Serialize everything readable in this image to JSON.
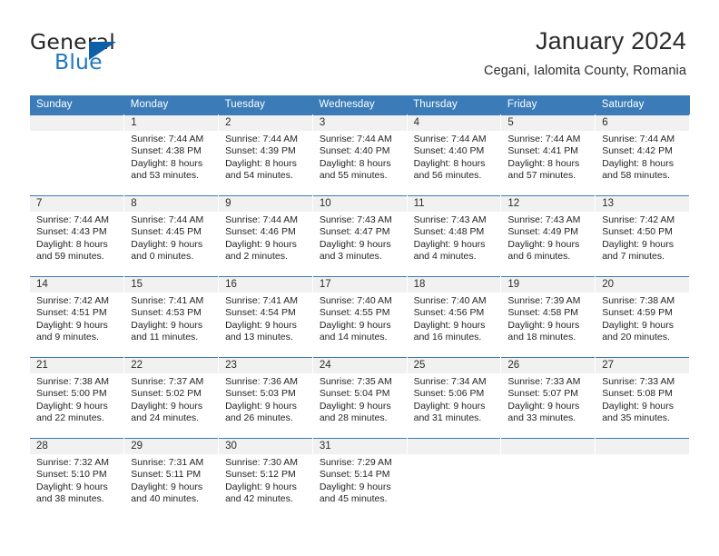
{
  "logo": {
    "word_top": "General",
    "word_bottom": "Blue",
    "accent_color": "#0f5fa8",
    "blue_text_color": "#2077c3"
  },
  "header": {
    "title": "January 2024",
    "subtitle": "Cegani, Ialomita County, Romania"
  },
  "calendar": {
    "header_bg": "#3b7cb8",
    "daynum_bg": "#f1f1f1",
    "weekdays": [
      "Sunday",
      "Monday",
      "Tuesday",
      "Wednesday",
      "Thursday",
      "Friday",
      "Saturday"
    ],
    "weeks": [
      [
        {
          "day": "",
          "sunrise": "",
          "sunset": "",
          "daylight_line1": "",
          "daylight_line2": ""
        },
        {
          "day": "1",
          "sunrise": "Sunrise: 7:44 AM",
          "sunset": "Sunset: 4:38 PM",
          "daylight_line1": "Daylight: 8 hours",
          "daylight_line2": "and 53 minutes."
        },
        {
          "day": "2",
          "sunrise": "Sunrise: 7:44 AM",
          "sunset": "Sunset: 4:39 PM",
          "daylight_line1": "Daylight: 8 hours",
          "daylight_line2": "and 54 minutes."
        },
        {
          "day": "3",
          "sunrise": "Sunrise: 7:44 AM",
          "sunset": "Sunset: 4:40 PM",
          "daylight_line1": "Daylight: 8 hours",
          "daylight_line2": "and 55 minutes."
        },
        {
          "day": "4",
          "sunrise": "Sunrise: 7:44 AM",
          "sunset": "Sunset: 4:40 PM",
          "daylight_line1": "Daylight: 8 hours",
          "daylight_line2": "and 56 minutes."
        },
        {
          "day": "5",
          "sunrise": "Sunrise: 7:44 AM",
          "sunset": "Sunset: 4:41 PM",
          "daylight_line1": "Daylight: 8 hours",
          "daylight_line2": "and 57 minutes."
        },
        {
          "day": "6",
          "sunrise": "Sunrise: 7:44 AM",
          "sunset": "Sunset: 4:42 PM",
          "daylight_line1": "Daylight: 8 hours",
          "daylight_line2": "and 58 minutes."
        }
      ],
      [
        {
          "day": "7",
          "sunrise": "Sunrise: 7:44 AM",
          "sunset": "Sunset: 4:43 PM",
          "daylight_line1": "Daylight: 8 hours",
          "daylight_line2": "and 59 minutes."
        },
        {
          "day": "8",
          "sunrise": "Sunrise: 7:44 AM",
          "sunset": "Sunset: 4:45 PM",
          "daylight_line1": "Daylight: 9 hours",
          "daylight_line2": "and 0 minutes."
        },
        {
          "day": "9",
          "sunrise": "Sunrise: 7:44 AM",
          "sunset": "Sunset: 4:46 PM",
          "daylight_line1": "Daylight: 9 hours",
          "daylight_line2": "and 2 minutes."
        },
        {
          "day": "10",
          "sunrise": "Sunrise: 7:43 AM",
          "sunset": "Sunset: 4:47 PM",
          "daylight_line1": "Daylight: 9 hours",
          "daylight_line2": "and 3 minutes."
        },
        {
          "day": "11",
          "sunrise": "Sunrise: 7:43 AM",
          "sunset": "Sunset: 4:48 PM",
          "daylight_line1": "Daylight: 9 hours",
          "daylight_line2": "and 4 minutes."
        },
        {
          "day": "12",
          "sunrise": "Sunrise: 7:43 AM",
          "sunset": "Sunset: 4:49 PM",
          "daylight_line1": "Daylight: 9 hours",
          "daylight_line2": "and 6 minutes."
        },
        {
          "day": "13",
          "sunrise": "Sunrise: 7:42 AM",
          "sunset": "Sunset: 4:50 PM",
          "daylight_line1": "Daylight: 9 hours",
          "daylight_line2": "and 7 minutes."
        }
      ],
      [
        {
          "day": "14",
          "sunrise": "Sunrise: 7:42 AM",
          "sunset": "Sunset: 4:51 PM",
          "daylight_line1": "Daylight: 9 hours",
          "daylight_line2": "and 9 minutes."
        },
        {
          "day": "15",
          "sunrise": "Sunrise: 7:41 AM",
          "sunset": "Sunset: 4:53 PM",
          "daylight_line1": "Daylight: 9 hours",
          "daylight_line2": "and 11 minutes."
        },
        {
          "day": "16",
          "sunrise": "Sunrise: 7:41 AM",
          "sunset": "Sunset: 4:54 PM",
          "daylight_line1": "Daylight: 9 hours",
          "daylight_line2": "and 13 minutes."
        },
        {
          "day": "17",
          "sunrise": "Sunrise: 7:40 AM",
          "sunset": "Sunset: 4:55 PM",
          "daylight_line1": "Daylight: 9 hours",
          "daylight_line2": "and 14 minutes."
        },
        {
          "day": "18",
          "sunrise": "Sunrise: 7:40 AM",
          "sunset": "Sunset: 4:56 PM",
          "daylight_line1": "Daylight: 9 hours",
          "daylight_line2": "and 16 minutes."
        },
        {
          "day": "19",
          "sunrise": "Sunrise: 7:39 AM",
          "sunset": "Sunset: 4:58 PM",
          "daylight_line1": "Daylight: 9 hours",
          "daylight_line2": "and 18 minutes."
        },
        {
          "day": "20",
          "sunrise": "Sunrise: 7:38 AM",
          "sunset": "Sunset: 4:59 PM",
          "daylight_line1": "Daylight: 9 hours",
          "daylight_line2": "and 20 minutes."
        }
      ],
      [
        {
          "day": "21",
          "sunrise": "Sunrise: 7:38 AM",
          "sunset": "Sunset: 5:00 PM",
          "daylight_line1": "Daylight: 9 hours",
          "daylight_line2": "and 22 minutes."
        },
        {
          "day": "22",
          "sunrise": "Sunrise: 7:37 AM",
          "sunset": "Sunset: 5:02 PM",
          "daylight_line1": "Daylight: 9 hours",
          "daylight_line2": "and 24 minutes."
        },
        {
          "day": "23",
          "sunrise": "Sunrise: 7:36 AM",
          "sunset": "Sunset: 5:03 PM",
          "daylight_line1": "Daylight: 9 hours",
          "daylight_line2": "and 26 minutes."
        },
        {
          "day": "24",
          "sunrise": "Sunrise: 7:35 AM",
          "sunset": "Sunset: 5:04 PM",
          "daylight_line1": "Daylight: 9 hours",
          "daylight_line2": "and 28 minutes."
        },
        {
          "day": "25",
          "sunrise": "Sunrise: 7:34 AM",
          "sunset": "Sunset: 5:06 PM",
          "daylight_line1": "Daylight: 9 hours",
          "daylight_line2": "and 31 minutes."
        },
        {
          "day": "26",
          "sunrise": "Sunrise: 7:33 AM",
          "sunset": "Sunset: 5:07 PM",
          "daylight_line1": "Daylight: 9 hours",
          "daylight_line2": "and 33 minutes."
        },
        {
          "day": "27",
          "sunrise": "Sunrise: 7:33 AM",
          "sunset": "Sunset: 5:08 PM",
          "daylight_line1": "Daylight: 9 hours",
          "daylight_line2": "and 35 minutes."
        }
      ],
      [
        {
          "day": "28",
          "sunrise": "Sunrise: 7:32 AM",
          "sunset": "Sunset: 5:10 PM",
          "daylight_line1": "Daylight: 9 hours",
          "daylight_line2": "and 38 minutes."
        },
        {
          "day": "29",
          "sunrise": "Sunrise: 7:31 AM",
          "sunset": "Sunset: 5:11 PM",
          "daylight_line1": "Daylight: 9 hours",
          "daylight_line2": "and 40 minutes."
        },
        {
          "day": "30",
          "sunrise": "Sunrise: 7:30 AM",
          "sunset": "Sunset: 5:12 PM",
          "daylight_line1": "Daylight: 9 hours",
          "daylight_line2": "and 42 minutes."
        },
        {
          "day": "31",
          "sunrise": "Sunrise: 7:29 AM",
          "sunset": "Sunset: 5:14 PM",
          "daylight_line1": "Daylight: 9 hours",
          "daylight_line2": "and 45 minutes."
        },
        {
          "day": "",
          "sunrise": "",
          "sunset": "",
          "daylight_line1": "",
          "daylight_line2": ""
        },
        {
          "day": "",
          "sunrise": "",
          "sunset": "",
          "daylight_line1": "",
          "daylight_line2": ""
        },
        {
          "day": "",
          "sunrise": "",
          "sunset": "",
          "daylight_line1": "",
          "daylight_line2": ""
        }
      ]
    ]
  }
}
